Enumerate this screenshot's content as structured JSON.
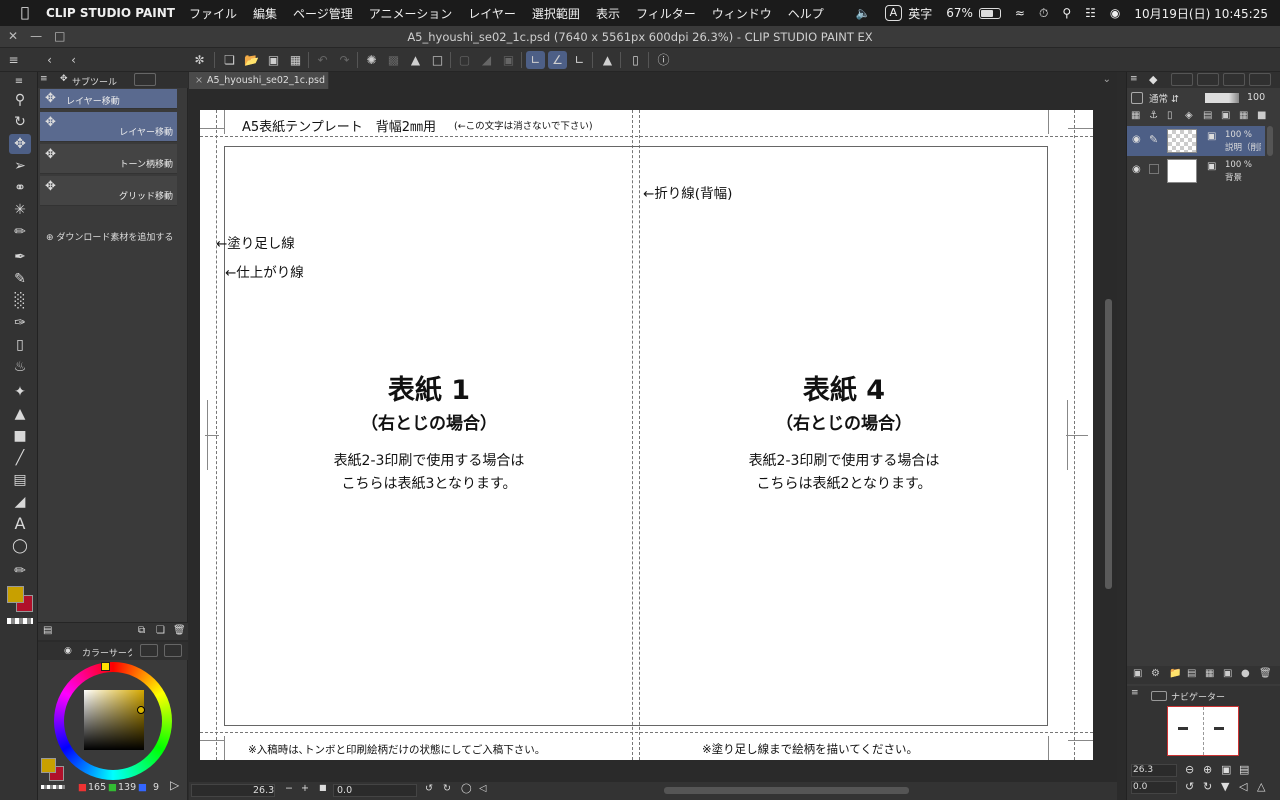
{
  "menubar": {
    "app_name": "CLIP STUDIO PAINT",
    "menus": [
      "ファイル",
      "編集",
      "ページ管理",
      "アニメーション",
      "レイヤー",
      "選択範囲",
      "表示",
      "フィルター",
      "ウィンドウ",
      "ヘルプ"
    ],
    "input_mode": "英字",
    "input_badge": "A",
    "battery": "67%",
    "battery_level": 0.67,
    "datetime": "10月19日(日) 10:45:25"
  },
  "window": {
    "title": "A5_hyoushi_se02_1c.psd (7640 x 5561px 600dpi 26.3%)  - CLIP STUDIO PAINT EX"
  },
  "subtool": {
    "tab_label": "サブツール",
    "items": [
      "レイヤー移動",
      "レイヤー移動",
      "トーン柄移動",
      "グリッド移動"
    ],
    "add_material": "ダウンロード素材を追加する"
  },
  "color": {
    "tab_label": "カラーサークル",
    "main_color": "#c8a000",
    "sub_color": "#b0102a",
    "r": "165",
    "g": "139",
    "b": "9"
  },
  "document": {
    "tab": "A5_hyoushi_se02_1c.psd",
    "header_title": "A5表紙テンプレート　背幅2㎜用",
    "header_note": "(←この文字は消さないで下さい)",
    "fold_line": "←折り線(背幅)",
    "bleed_line": "←塗り足し線",
    "trim_line": "←仕上がり線",
    "left_page": {
      "title": "表紙 1",
      "subtitle": "（右とじの場合）",
      "body1": "表紙2-3印刷で使用する場合は",
      "body2": "こちらは表紙3となります。"
    },
    "right_page": {
      "title": "表紙 4",
      "subtitle": "（右とじの場合）",
      "body1": "表紙2-3印刷で使用する場合は",
      "body2": "こちらは表紙2となります。"
    },
    "footer_left": "※入稿時は､トンボと印刷絵柄だけの状態にしてご入稿下さい。",
    "footer_right": "※塗り足し線まで絵柄を描いてください。"
  },
  "status": {
    "zoom": "26.3",
    "angle": "0.0"
  },
  "layers": {
    "blend_mode": "通常",
    "opacity": "100",
    "items": [
      {
        "opacity": "100 %",
        "name": "説明（削除"
      },
      {
        "opacity": "100 %",
        "name": "背景"
      }
    ]
  },
  "navigator": {
    "tab_label": "ナビゲーター",
    "zoom": "26.3",
    "angle": "0.0"
  }
}
